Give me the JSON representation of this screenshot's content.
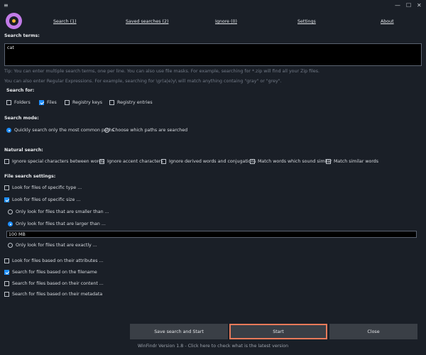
{
  "window": {
    "menu_glyph": "≡",
    "minimize_glyph": "—",
    "maximize_glyph": "☐",
    "close_glyph": "✕"
  },
  "tabs": [
    {
      "label": "Search (1)"
    },
    {
      "label": "Saved searches (2)"
    },
    {
      "label": "Ignore (0)"
    },
    {
      "label": "Settings"
    },
    {
      "label": "About"
    }
  ],
  "search_terms": {
    "title": "Search terms:",
    "value": "cat",
    "tip1": "Tip: You can enter multiple search terms, one per line. You can also use file masks. For example, searching for *.zip will find all your Zip files.",
    "tip2": "You can also enter Regular Expressions. For example, searching for \\gr(a|e)y\\ will match anything containg \"gray\" or \"grey\"."
  },
  "search_for": {
    "title": "Search for:",
    "options": [
      {
        "label": "Folders",
        "checked": false
      },
      {
        "label": "Files",
        "checked": true
      },
      {
        "label": "Registry keys",
        "checked": false
      },
      {
        "label": "Registry entries",
        "checked": false
      }
    ]
  },
  "search_mode": {
    "title": "Search mode:",
    "options": [
      {
        "label": "Quickly search only the most common paths",
        "selected": true
      },
      {
        "label": "Choose which paths are searched",
        "selected": false
      }
    ]
  },
  "natural_search": {
    "title": "Natural search:",
    "options": [
      {
        "label": "Ignore special characters between words",
        "checked": false
      },
      {
        "label": "Ignore accent characters",
        "checked": false
      },
      {
        "label": "Ignore derived words and conjugations",
        "checked": false
      },
      {
        "label": "Match words which sound similar",
        "checked": false
      },
      {
        "label": "Match similar words",
        "checked": false
      }
    ]
  },
  "file_settings": {
    "title": "File search settings:",
    "specific_type": {
      "label": "Look for files of specific type ...",
      "checked": false
    },
    "specific_size": {
      "label": "Look for files of specific size ...",
      "checked": true
    },
    "size_options": [
      {
        "label": "Only look for files that are smaller than ...",
        "selected": false
      },
      {
        "label": "Only look for files that are larger than ...",
        "selected": true
      }
    ],
    "size_value": "100 MB",
    "exact_option": {
      "label": "Only look for files that are exactly ...",
      "selected": false
    },
    "attributes": {
      "label": "Look for files based on their attributes ...",
      "checked": false
    },
    "filename": {
      "label": "Search for files based on the filename",
      "checked": true
    },
    "content": {
      "label": "Search for files based on their content ...",
      "checked": false
    },
    "metadata": {
      "label": "Search for files based on their metadata",
      "checked": false
    }
  },
  "buttons": {
    "save_start": "Save search and Start",
    "start": "Start",
    "close": "Close"
  },
  "footer": "WinFindr Version 1.8 - Click here to check what is the latest version",
  "colors": {
    "background": "#1a1f27",
    "accent_blue": "#1f8fff",
    "start_border": "#e87a5a",
    "logo_purple": "#c27be8",
    "logo_orange": "#f2b233"
  }
}
